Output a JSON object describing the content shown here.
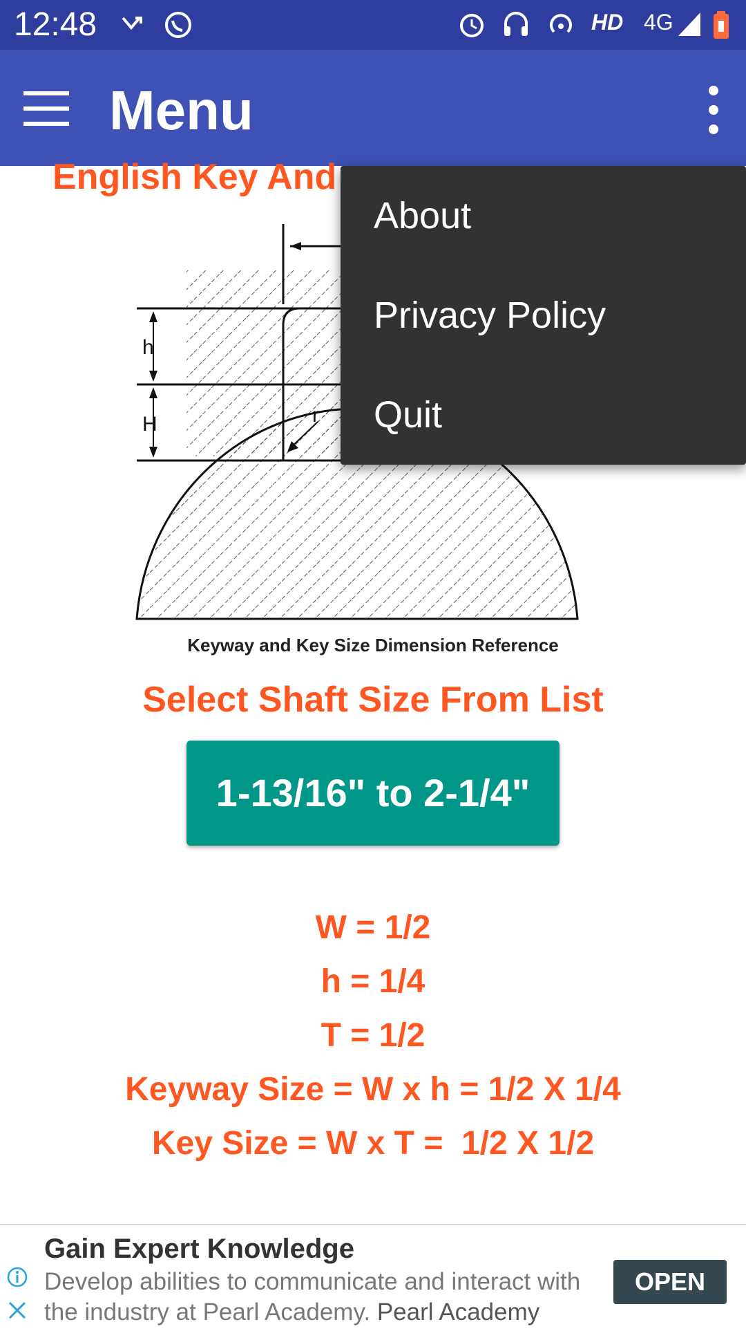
{
  "status_bar": {
    "time": "12:48",
    "network": "HD",
    "signal_type": "4G",
    "icons": [
      "missed-call-icon",
      "whatsapp-icon",
      "alarm-icon",
      "headset-icon",
      "hotspot-icon",
      "signal-icon",
      "battery-icon"
    ]
  },
  "appbar": {
    "title": "Menu",
    "menu_icon": "hamburger-icon",
    "overflow_icon": "more-vert-icon"
  },
  "content": {
    "heading": "English Key And",
    "diagram_caption": "Keyway and Key Size Dimension Reference",
    "diagram_labels": {
      "h": "h",
      "H": "H",
      "r": "r"
    },
    "select_label": "Select Shaft Size From List",
    "shaft_selected": "1-13/16\" to 2-1/4\"",
    "results": [
      "W = 1/2",
      "h = 1/4",
      "T = 1/2",
      "Keyway Size = W x h = 1/2 X 1/4",
      "Key Size = W x T =  1/2 X 1/2"
    ]
  },
  "overflow_menu": {
    "items": [
      "About",
      "Privacy Policy",
      "Quit"
    ]
  },
  "ad": {
    "title": "Gain Expert Knowledge",
    "body": "Develop abilities to communicate and interact with the industry at Pearl Academy.",
    "brand": "Pearl Academy",
    "open_label": "OPEN"
  },
  "colors": {
    "status_bar": "#2f3e9e",
    "app_bar": "#3f51b5",
    "accent_text": "#ff5722",
    "button": "#009688",
    "menu_bg": "#323232"
  }
}
